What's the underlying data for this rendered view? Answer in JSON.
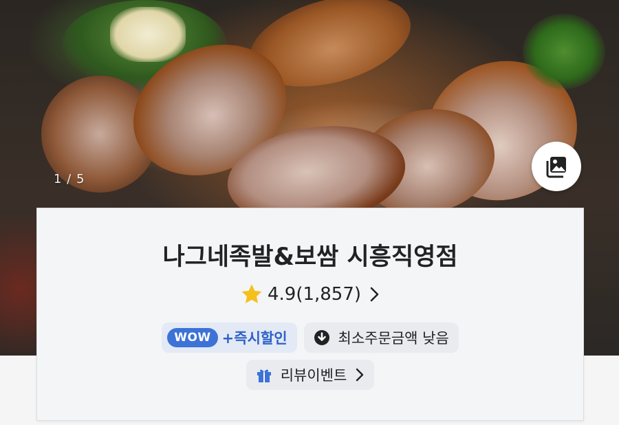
{
  "hero": {
    "image_counter": "1 / 5",
    "gallery_icon": "photo-gallery-icon"
  },
  "store": {
    "name": "나그네족발&보쌈 시흥직영점",
    "rating": "4.9",
    "review_count": "(1,857)",
    "rating_icon": "star-icon",
    "star_color": "#f5c01a"
  },
  "badges": {
    "wow_label": "WOW",
    "wow_text": "+즉시할인",
    "min_order": "최소주문금액 낮음",
    "review_event": "리뷰이벤트"
  },
  "colors": {
    "wow_accent": "#3d72d6",
    "gift_icon": "#3d72d6"
  }
}
